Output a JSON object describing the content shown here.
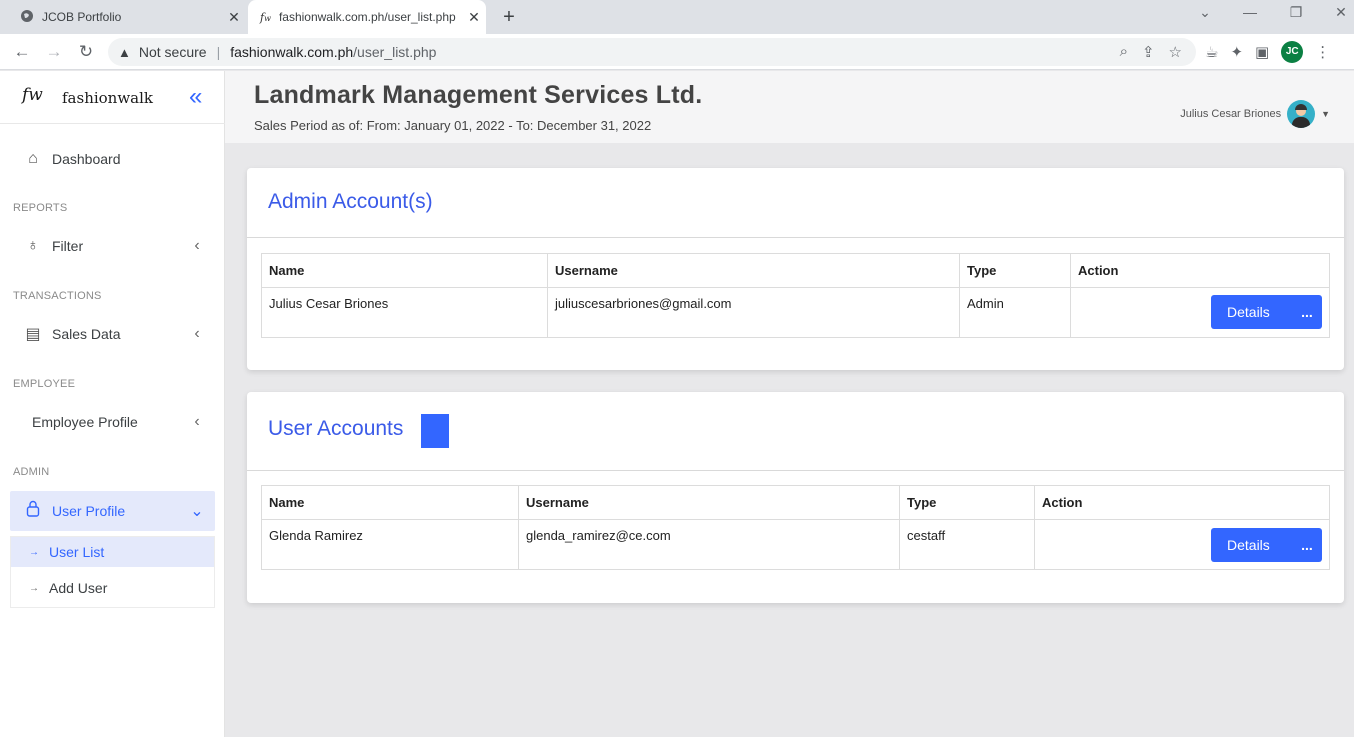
{
  "browser": {
    "tabs": [
      {
        "title": "JCOB Portfolio",
        "active": false,
        "icon": "globe-icon"
      },
      {
        "title": "fashionwalk.com.ph/user_list.php",
        "active": true,
        "icon": "fw-favicon"
      }
    ],
    "security_label": "Not secure",
    "url_host": "fashionwalk.com.ph",
    "url_path": "/user_list.php",
    "profile_initials": "JC",
    "profile_color": "#0b8043"
  },
  "sidebar": {
    "logo_mark": "fw",
    "brand_name": "fashionwalk",
    "dashboard_label": "Dashboard",
    "sections": {
      "reports": "REPORTS",
      "transactions": "TRANSACTIONS",
      "employee": "EMPLOYEE",
      "admin": "ADMIN"
    },
    "items": {
      "filter": "Filter",
      "sales_data": "Sales Data",
      "employee_profile": "Employee Profile",
      "user_profile": "User Profile"
    },
    "submenu": {
      "user_list": "User List",
      "add_user": "Add User"
    },
    "accent": "#3366ff"
  },
  "header": {
    "company": "Landmark Management Services Ltd.",
    "period": "Sales Period as of: From: January 01, 2022 - To: December 31, 2022",
    "user_name": "Julius Cesar Briones"
  },
  "admin_card": {
    "title": "Admin Account(s)",
    "columns": [
      "Name",
      "Username",
      "Type",
      "Action"
    ],
    "rows": [
      {
        "name": "Julius Cesar Briones",
        "username": "juliuscesarbriones@gmail.com",
        "type": "Admin",
        "action": "Details",
        "more": "..."
      }
    ]
  },
  "user_card": {
    "title": "User Accounts",
    "columns": [
      "Name",
      "Username",
      "Type",
      "Action"
    ],
    "rows": [
      {
        "name": "Glenda Ramirez",
        "username": "glenda_ramirez@ce.com",
        "type": "cestaff",
        "action": "Details",
        "more": "..."
      }
    ]
  }
}
